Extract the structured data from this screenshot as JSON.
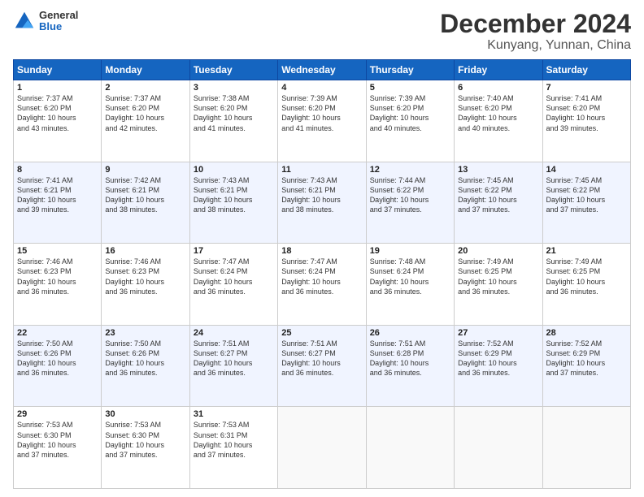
{
  "logo": {
    "general": "General",
    "blue": "Blue"
  },
  "title": "December 2024",
  "subtitle": "Kunyang, Yunnan, China",
  "days_of_week": [
    "Sunday",
    "Monday",
    "Tuesday",
    "Wednesday",
    "Thursday",
    "Friday",
    "Saturday"
  ],
  "weeks": [
    [
      {
        "day": "1",
        "sunrise": "7:37 AM",
        "sunset": "6:20 PM",
        "daylight": "10 hours and 43 minutes."
      },
      {
        "day": "2",
        "sunrise": "7:37 AM",
        "sunset": "6:20 PM",
        "daylight": "10 hours and 42 minutes."
      },
      {
        "day": "3",
        "sunrise": "7:38 AM",
        "sunset": "6:20 PM",
        "daylight": "10 hours and 41 minutes."
      },
      {
        "day": "4",
        "sunrise": "7:39 AM",
        "sunset": "6:20 PM",
        "daylight": "10 hours and 41 minutes."
      },
      {
        "day": "5",
        "sunrise": "7:39 AM",
        "sunset": "6:20 PM",
        "daylight": "10 hours and 40 minutes."
      },
      {
        "day": "6",
        "sunrise": "7:40 AM",
        "sunset": "6:20 PM",
        "daylight": "10 hours and 40 minutes."
      },
      {
        "day": "7",
        "sunrise": "7:41 AM",
        "sunset": "6:20 PM",
        "daylight": "10 hours and 39 minutes."
      }
    ],
    [
      {
        "day": "8",
        "sunrise": "7:41 AM",
        "sunset": "6:21 PM",
        "daylight": "10 hours and 39 minutes."
      },
      {
        "day": "9",
        "sunrise": "7:42 AM",
        "sunset": "6:21 PM",
        "daylight": "10 hours and 38 minutes."
      },
      {
        "day": "10",
        "sunrise": "7:43 AM",
        "sunset": "6:21 PM",
        "daylight": "10 hours and 38 minutes."
      },
      {
        "day": "11",
        "sunrise": "7:43 AM",
        "sunset": "6:21 PM",
        "daylight": "10 hours and 38 minutes."
      },
      {
        "day": "12",
        "sunrise": "7:44 AM",
        "sunset": "6:22 PM",
        "daylight": "10 hours and 37 minutes."
      },
      {
        "day": "13",
        "sunrise": "7:45 AM",
        "sunset": "6:22 PM",
        "daylight": "10 hours and 37 minutes."
      },
      {
        "day": "14",
        "sunrise": "7:45 AM",
        "sunset": "6:22 PM",
        "daylight": "10 hours and 37 minutes."
      }
    ],
    [
      {
        "day": "15",
        "sunrise": "7:46 AM",
        "sunset": "6:23 PM",
        "daylight": "10 hours and 36 minutes."
      },
      {
        "day": "16",
        "sunrise": "7:46 AM",
        "sunset": "6:23 PM",
        "daylight": "10 hours and 36 minutes."
      },
      {
        "day": "17",
        "sunrise": "7:47 AM",
        "sunset": "6:24 PM",
        "daylight": "10 hours and 36 minutes."
      },
      {
        "day": "18",
        "sunrise": "7:47 AM",
        "sunset": "6:24 PM",
        "daylight": "10 hours and 36 minutes."
      },
      {
        "day": "19",
        "sunrise": "7:48 AM",
        "sunset": "6:24 PM",
        "daylight": "10 hours and 36 minutes."
      },
      {
        "day": "20",
        "sunrise": "7:49 AM",
        "sunset": "6:25 PM",
        "daylight": "10 hours and 36 minutes."
      },
      {
        "day": "21",
        "sunrise": "7:49 AM",
        "sunset": "6:25 PM",
        "daylight": "10 hours and 36 minutes."
      }
    ],
    [
      {
        "day": "22",
        "sunrise": "7:50 AM",
        "sunset": "6:26 PM",
        "daylight": "10 hours and 36 minutes."
      },
      {
        "day": "23",
        "sunrise": "7:50 AM",
        "sunset": "6:26 PM",
        "daylight": "10 hours and 36 minutes."
      },
      {
        "day": "24",
        "sunrise": "7:51 AM",
        "sunset": "6:27 PM",
        "daylight": "10 hours and 36 minutes."
      },
      {
        "day": "25",
        "sunrise": "7:51 AM",
        "sunset": "6:27 PM",
        "daylight": "10 hours and 36 minutes."
      },
      {
        "day": "26",
        "sunrise": "7:51 AM",
        "sunset": "6:28 PM",
        "daylight": "10 hours and 36 minutes."
      },
      {
        "day": "27",
        "sunrise": "7:52 AM",
        "sunset": "6:29 PM",
        "daylight": "10 hours and 36 minutes."
      },
      {
        "day": "28",
        "sunrise": "7:52 AM",
        "sunset": "6:29 PM",
        "daylight": "10 hours and 37 minutes."
      }
    ],
    [
      {
        "day": "29",
        "sunrise": "7:53 AM",
        "sunset": "6:30 PM",
        "daylight": "10 hours and 37 minutes."
      },
      {
        "day": "30",
        "sunrise": "7:53 AM",
        "sunset": "6:30 PM",
        "daylight": "10 hours and 37 minutes."
      },
      {
        "day": "31",
        "sunrise": "7:53 AM",
        "sunset": "6:31 PM",
        "daylight": "10 hours and 37 minutes."
      },
      null,
      null,
      null,
      null
    ]
  ]
}
